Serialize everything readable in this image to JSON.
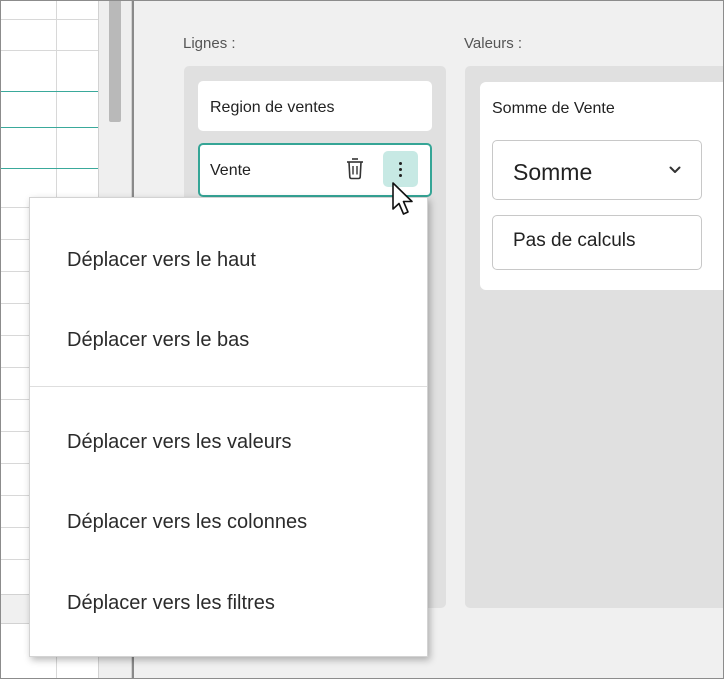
{
  "pivot": {
    "rows_label": "Lignes :",
    "values_label": "Valeurs :",
    "rows_items": [
      {
        "label": "Region de ventes"
      },
      {
        "label": "Vente"
      }
    ],
    "values_card": {
      "title": "Somme de Vente",
      "aggregation": "Somme",
      "calc_label": "Pas de calculs"
    }
  },
  "context_menu": {
    "items": [
      {
        "label": "Déplacer vers le haut"
      },
      {
        "label": "Déplacer vers le bas"
      },
      {
        "label": "Déplacer vers les valeurs"
      },
      {
        "label": "Déplacer vers les colonnes"
      },
      {
        "label": "Déplacer vers les filtres"
      }
    ]
  },
  "colors": {
    "accent": "#35a596",
    "accent_light": "#c7e9e4",
    "zone_bg": "#e0e0e0",
    "panel_bg": "#f0f0f0"
  },
  "icons": {
    "delete": "trash-icon",
    "more": "kebab-menu-icon",
    "dropdown": "chevron-down-icon",
    "pointer": "mouse-cursor-icon"
  }
}
